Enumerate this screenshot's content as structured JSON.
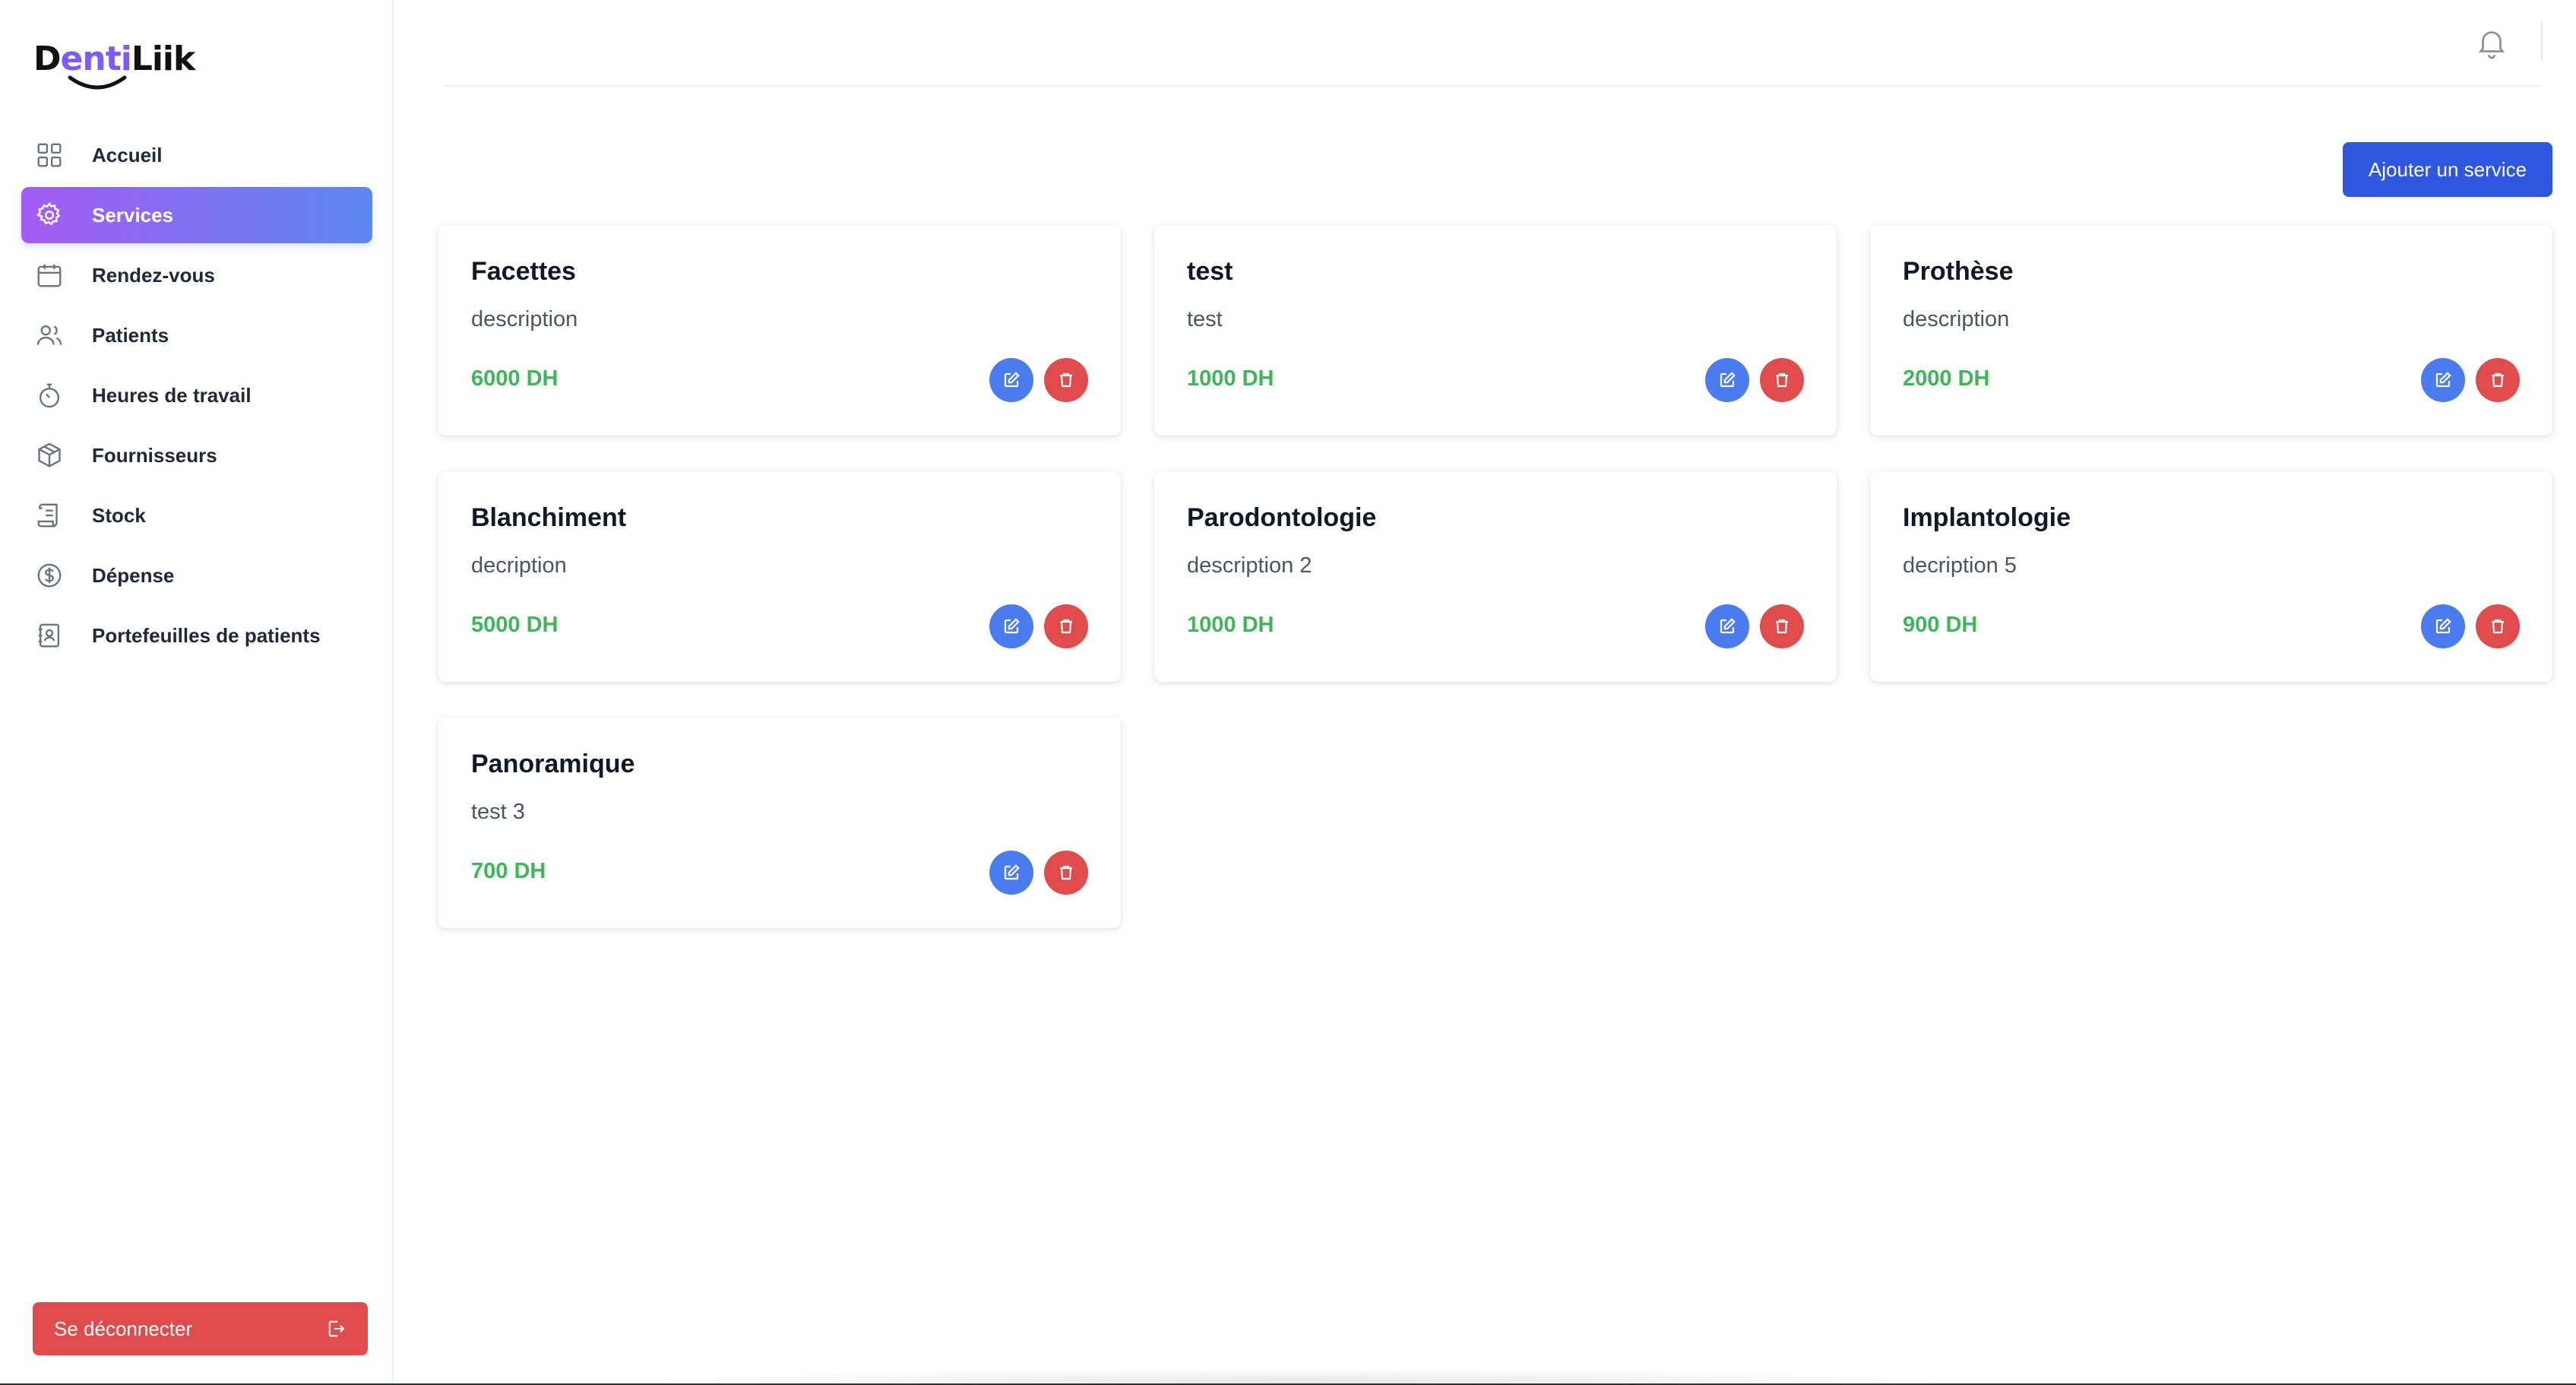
{
  "brand": {
    "part1": "D",
    "part2": "enti",
    "part3": "Liik"
  },
  "sidebar": {
    "items": [
      {
        "label": "Accueil",
        "icon": "grid-icon",
        "active": false
      },
      {
        "label": "Services",
        "icon": "gear-icon",
        "active": true
      },
      {
        "label": "Rendez-vous",
        "icon": "calendar-icon",
        "active": false
      },
      {
        "label": "Patients",
        "icon": "users-icon",
        "active": false
      },
      {
        "label": "Heures de travail",
        "icon": "stopwatch-icon",
        "active": false
      },
      {
        "label": "Fournisseurs",
        "icon": "package-icon",
        "active": false
      },
      {
        "label": "Stock",
        "icon": "scroll-icon",
        "active": false
      },
      {
        "label": "Dépense",
        "icon": "dollar-circle-icon",
        "active": false
      },
      {
        "label": "Portefeuilles de patients",
        "icon": "contact-book-icon",
        "active": false
      }
    ],
    "logout_label": "Se déconnecter"
  },
  "header": {
    "notification_icon": "bell-icon"
  },
  "main": {
    "add_button_label": "Ajouter un service",
    "services": [
      {
        "title": "Facettes",
        "description": "description",
        "price": "6000 DH"
      },
      {
        "title": "test",
        "description": "test",
        "price": "1000 DH"
      },
      {
        "title": "Prothèse",
        "description": "description",
        "price": "2000 DH"
      },
      {
        "title": "Blanchiment",
        "description": "decription",
        "price": "5000 DH"
      },
      {
        "title": "Parodontologie",
        "description": "description 2",
        "price": "1000 DH"
      },
      {
        "title": "Implantologie",
        "description": "decription 5",
        "price": "900 DH"
      },
      {
        "title": "Panoramique",
        "description": "test 3",
        "price": "700 DH"
      }
    ]
  },
  "colors": {
    "accent_gradient_start": "#a55bf5",
    "accent_gradient_end": "#5b87f0",
    "primary_button": "#2f56e0",
    "edit_button": "#4a7cf0",
    "delete_button": "#e04b4b",
    "price_text": "#3fb65a"
  }
}
